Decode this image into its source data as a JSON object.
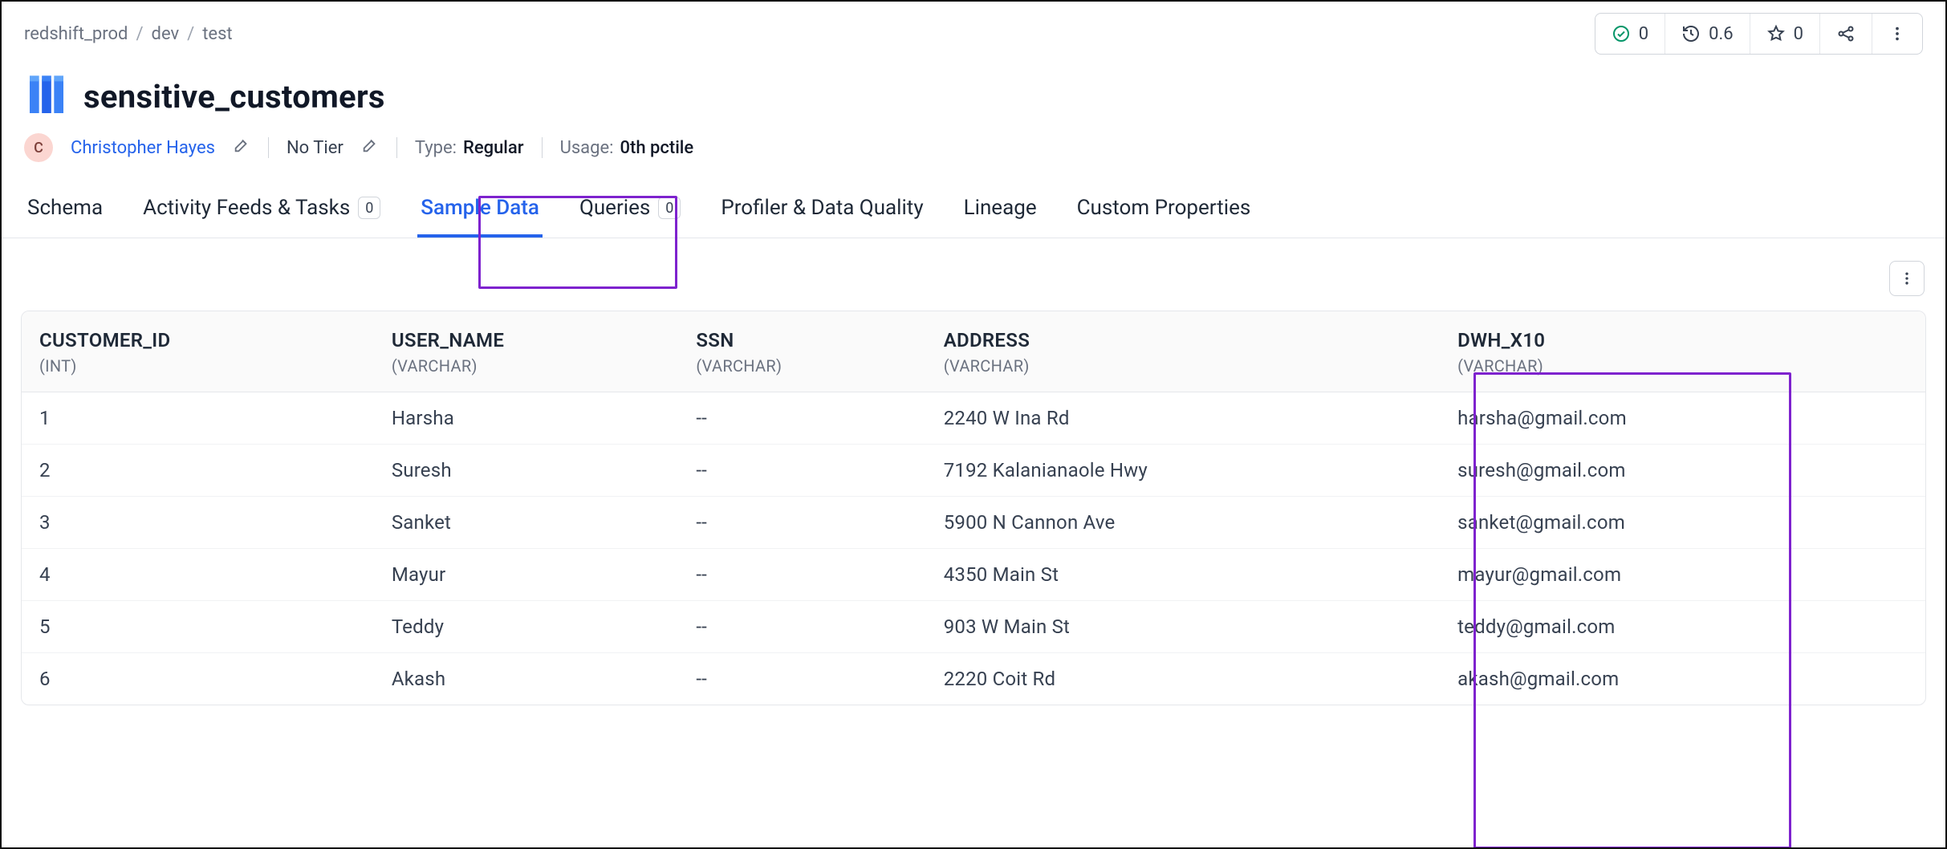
{
  "breadcrumb": [
    "redshift_prod",
    "dev",
    "test"
  ],
  "stats": {
    "check": "0",
    "clock": "0.6",
    "star": "0"
  },
  "title": "sensitive_customers",
  "owner": {
    "initial": "C",
    "name": "Christopher Hayes"
  },
  "tier": "No Tier",
  "type_label": "Type:",
  "type_value": "Regular",
  "usage_label": "Usage:",
  "usage_value": "0th pctile",
  "tabs": {
    "schema": "Schema",
    "activity": "Activity Feeds & Tasks",
    "activity_count": "0",
    "sample": "Sample Data",
    "queries": "Queries",
    "queries_count": "0",
    "profiler": "Profiler & Data Quality",
    "lineage": "Lineage",
    "custom": "Custom Properties"
  },
  "columns": [
    {
      "name": "CUSTOMER_ID",
      "type": "(INT)"
    },
    {
      "name": "USER_NAME",
      "type": "(VARCHAR)"
    },
    {
      "name": "SSN",
      "type": "(VARCHAR)"
    },
    {
      "name": "ADDRESS",
      "type": "(VARCHAR)"
    },
    {
      "name": "DWH_X10",
      "type": "(VARCHAR)"
    }
  ],
  "rows": [
    {
      "id": "1",
      "user": "Harsha",
      "ssn": "--",
      "address": "2240 W Ina Rd",
      "dwh": "harsha@gmail.com"
    },
    {
      "id": "2",
      "user": "Suresh",
      "ssn": "--",
      "address": "7192 Kalanianaole Hwy",
      "dwh": "suresh@gmail.com"
    },
    {
      "id": "3",
      "user": "Sanket",
      "ssn": "--",
      "address": "5900 N Cannon Ave",
      "dwh": "sanket@gmail.com"
    },
    {
      "id": "4",
      "user": "Mayur",
      "ssn": "--",
      "address": "4350 Main St",
      "dwh": "mayur@gmail.com"
    },
    {
      "id": "5",
      "user": "Teddy",
      "ssn": "--",
      "address": "903 W Main St",
      "dwh": "teddy@gmail.com"
    },
    {
      "id": "6",
      "user": "Akash",
      "ssn": "--",
      "address": "2220 Coit Rd",
      "dwh": "akash@gmail.com"
    }
  ]
}
